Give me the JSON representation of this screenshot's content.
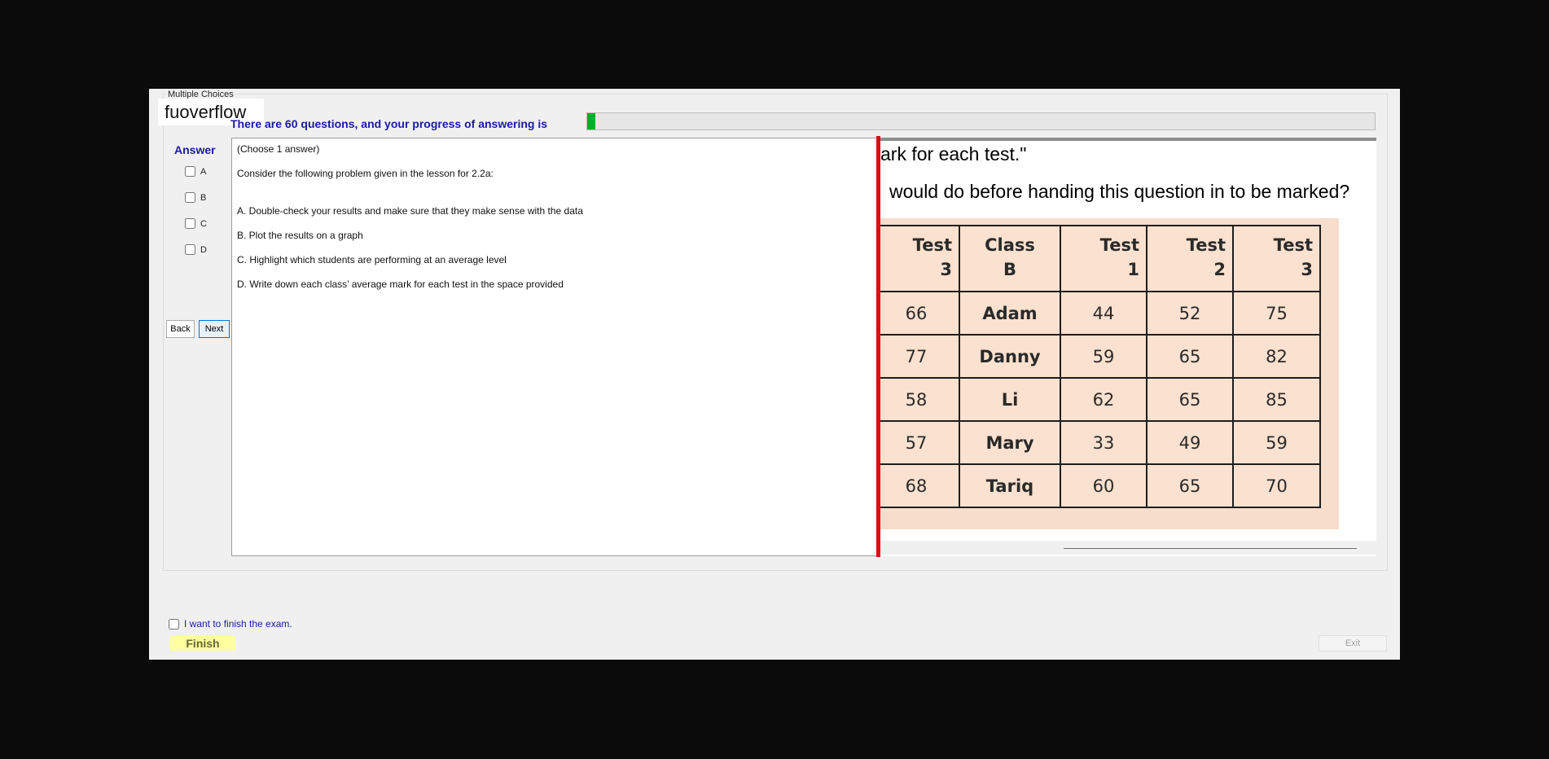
{
  "window": {
    "group_title": "Multiple Choices"
  },
  "watermark": "fuoverflow",
  "progress": {
    "label": "There are 60 questions, and your progress of answering is",
    "fraction": 0.01,
    "fill_color": "#06b025"
  },
  "answer": {
    "title": "Answer",
    "options": [
      {
        "label": "A"
      },
      {
        "label": "B"
      },
      {
        "label": "C"
      },
      {
        "label": "D"
      }
    ]
  },
  "nav": {
    "back_label": "Back",
    "next_label": "Next"
  },
  "question": {
    "instruction": "(Choose 1 answer)",
    "prompt": "Consider the following problem given in the lesson for 2.2a:",
    "choices": [
      "A.  Double-check your results and make sure that they make sense with the data",
      "B.  Plot the results on a graph",
      "C.  Highlight which students are performing at an average level",
      "D.  Write down each class’ average mark for each test in the space provided"
    ]
  },
  "image": {
    "line1": "ark for each test.\"",
    "line2": "would do before handing this question in to be marked?",
    "table": {
      "headers": [
        {
          "top": "Test",
          "bottom": "3"
        },
        {
          "top": "Class",
          "bottom": "B"
        },
        {
          "top": "Test",
          "bottom": "1"
        },
        {
          "top": "Test",
          "bottom": "2"
        },
        {
          "top": "Test",
          "bottom": "3"
        }
      ],
      "rows": [
        [
          "66",
          "Adam",
          "44",
          "52",
          "75"
        ],
        [
          "77",
          "Danny",
          "59",
          "65",
          "82"
        ],
        [
          "58",
          "Li",
          "62",
          "65",
          "85"
        ],
        [
          "57",
          "Mary",
          "33",
          "49",
          "59"
        ],
        [
          "68",
          "Tariq",
          "60",
          "65",
          "70"
        ]
      ]
    }
  },
  "finish": {
    "checkbox_label": "I want to finish the exam.",
    "button_label": "Finish"
  },
  "exit_label": "Exit"
}
